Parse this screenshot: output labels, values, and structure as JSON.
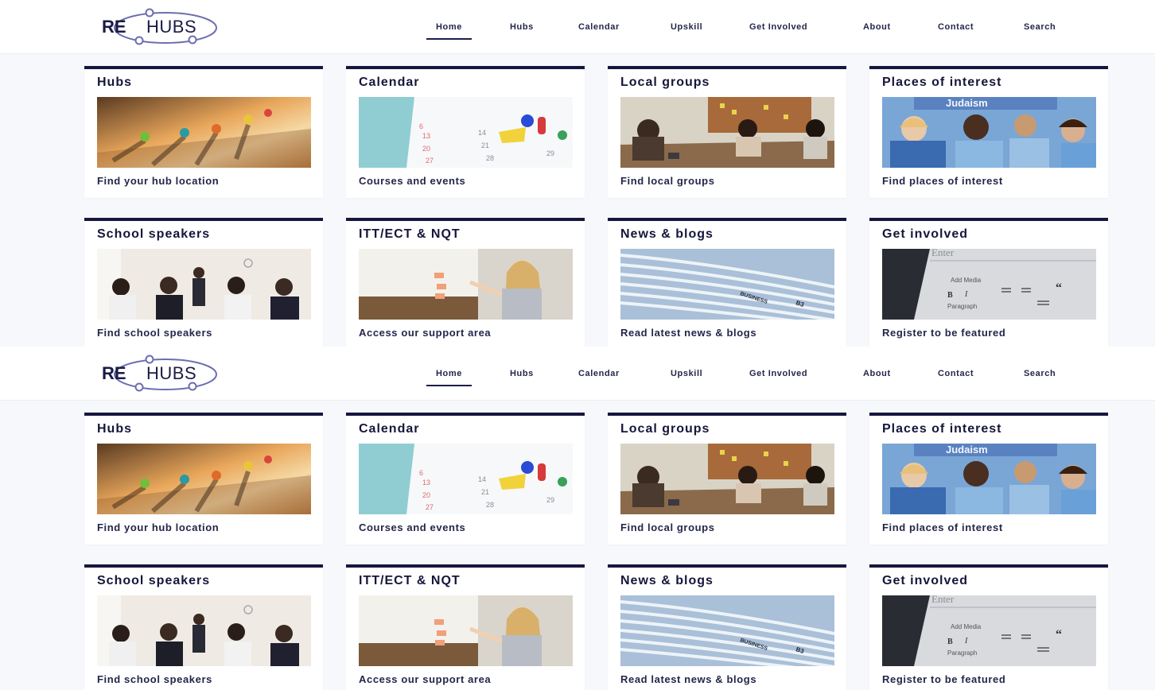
{
  "brand": {
    "logo_left": "RE",
    "logo_right": "HUBS",
    "accent": "#16173f",
    "link_color": "#23264a",
    "orb_color": "#6b6fb0"
  },
  "nav": [
    {
      "label": "Home",
      "active": true
    },
    {
      "label": "Hubs"
    },
    {
      "label": "Calendar"
    },
    {
      "label": "Upskill"
    },
    {
      "label": "Get Involved"
    },
    {
      "label": "About"
    },
    {
      "label": "Contact"
    },
    {
      "label": "Search"
    }
  ],
  "cards": [
    {
      "title": "Hubs",
      "link": "Find your hub location",
      "image": "map-pins-photo"
    },
    {
      "title": "Calendar",
      "link": "Courses and events",
      "image": "calendar-pins-photo"
    },
    {
      "title": "Local groups",
      "link": "Find local groups",
      "image": "meeting-table-photo"
    },
    {
      "title": "Places of interest",
      "link": "Find places of interest",
      "image": "children-classroom-photo"
    },
    {
      "title": "School speakers",
      "link": "Find school speakers",
      "image": "speaker-audience-photo"
    },
    {
      "title": "ITT/ECT & NQT",
      "link": "Access our support area",
      "image": "teacher-whiteboard-photo"
    },
    {
      "title": "News & blogs",
      "link": "Read latest news & blogs",
      "image": "newspapers-photo"
    },
    {
      "title": "Get involved",
      "link": "Register to be featured",
      "image": "editor-toolbar-photo"
    }
  ],
  "image_text": {
    "classroom_banner": "Judaism",
    "calendar_numbers": [
      "6",
      "13",
      "14",
      "20",
      "21",
      "27",
      "28",
      "29"
    ],
    "newspaper_headline": "BUSINESS",
    "newspaper_page": "B3",
    "editor_placeholder": "Enter",
    "editor_add_media": "Add Media",
    "editor_paragraph": "Paragraph",
    "editor_bold": "B",
    "editor_italic": "I",
    "editor_quote": "“"
  }
}
